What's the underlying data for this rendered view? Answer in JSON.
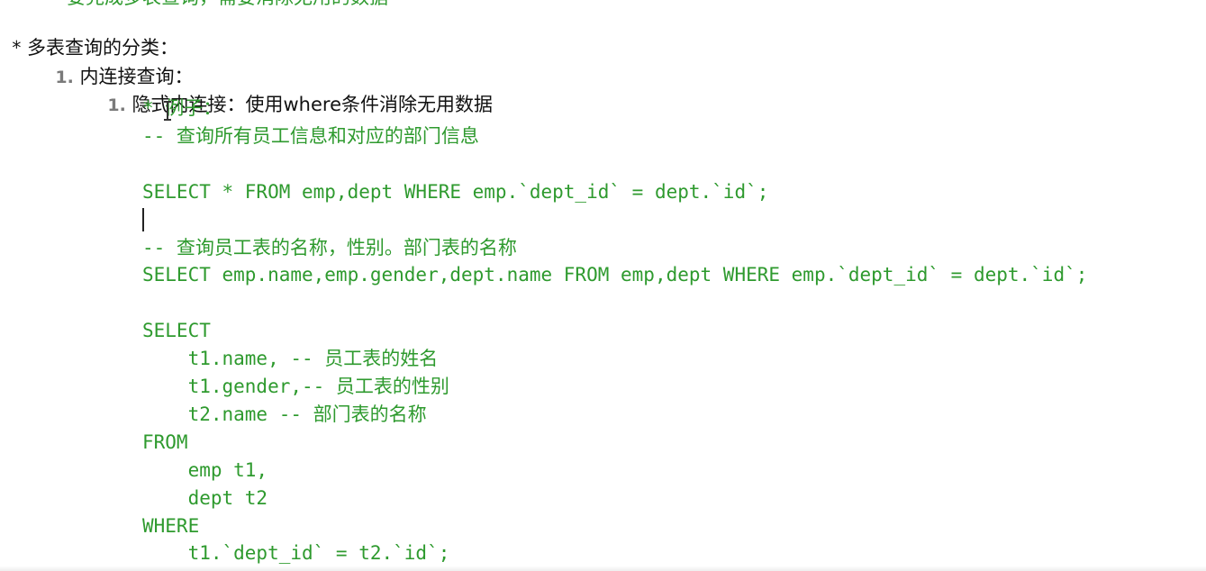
{
  "top_cut_text": "要完成多表查询，需要消除无用的数据",
  "outline": {
    "level0": {
      "bullet": "*",
      "text": "多表查询的分类："
    },
    "level1": {
      "number": "1.",
      "text": "内连接查询："
    },
    "level2": {
      "number": "1.",
      "text": "隐式内连接：使用where条件消除无用数据"
    }
  },
  "code_lines": [
    "* 例子：",
    "-- 查询所有员工信息和对应的部门信息",
    "",
    "SELECT * FROM emp,dept WHERE emp.`dept_id` = dept.`id`;",
    "",
    "-- 查询员工表的名称，性别。部门表的名称",
    "SELECT emp.name,emp.gender,dept.name FROM emp,dept WHERE emp.`dept_id` = dept.`id`;",
    "",
    "SELECT",
    "    t1.name, -- 员工表的姓名",
    "    t1.gender,-- 员工表的性别",
    "    t2.name -- 部门表的名称",
    "FROM",
    "    emp t1,",
    "    dept t2",
    "WHERE",
    "    t1.`dept_id` = t2.`id`;"
  ],
  "colors": {
    "code": "#2e9a2e",
    "text": "#111111",
    "numbers": "#7a7a7a"
  }
}
